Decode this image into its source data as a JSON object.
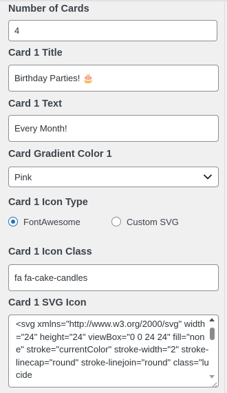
{
  "form": {
    "num_cards": {
      "label": "Number of Cards",
      "value": "4"
    },
    "card1_title": {
      "label": "Card 1 Title",
      "value": "Birthday Parties! 🎂"
    },
    "card1_text": {
      "label": "Card 1 Text",
      "value": "Every Month!"
    },
    "gradient1": {
      "label": "Card Gradient Color 1",
      "value": "Pink"
    },
    "icon_type": {
      "label": "Card 1 Icon Type",
      "options": [
        "FontAwesome",
        "Custom SVG"
      ],
      "selected": "FontAwesome"
    },
    "icon_class": {
      "label": "Card 1 Icon Class",
      "value": "fa fa-cake-candles"
    },
    "svg_icon": {
      "label": "Card 1 SVG Icon",
      "value": "<svg xmlns=\"http://www.w3.org/2000/svg\" width=\"24\" height=\"24\" viewBox=\"0 0 24 24\" fill=\"none\" stroke=\"currentColor\" stroke-width=\"2\" stroke-linecap=\"round\" stroke-linejoin=\"round\" class=\"lucide"
    }
  },
  "icons": {
    "select_arrow": "chevron-down-icon",
    "scroll_up": "arrow-up-icon",
    "scroll_down": "arrow-down-icon",
    "resize": "resize-grip-icon"
  },
  "colors": {
    "accent": "#2271b1",
    "border": "#8c8f94",
    "background": "#f0f0f1"
  }
}
